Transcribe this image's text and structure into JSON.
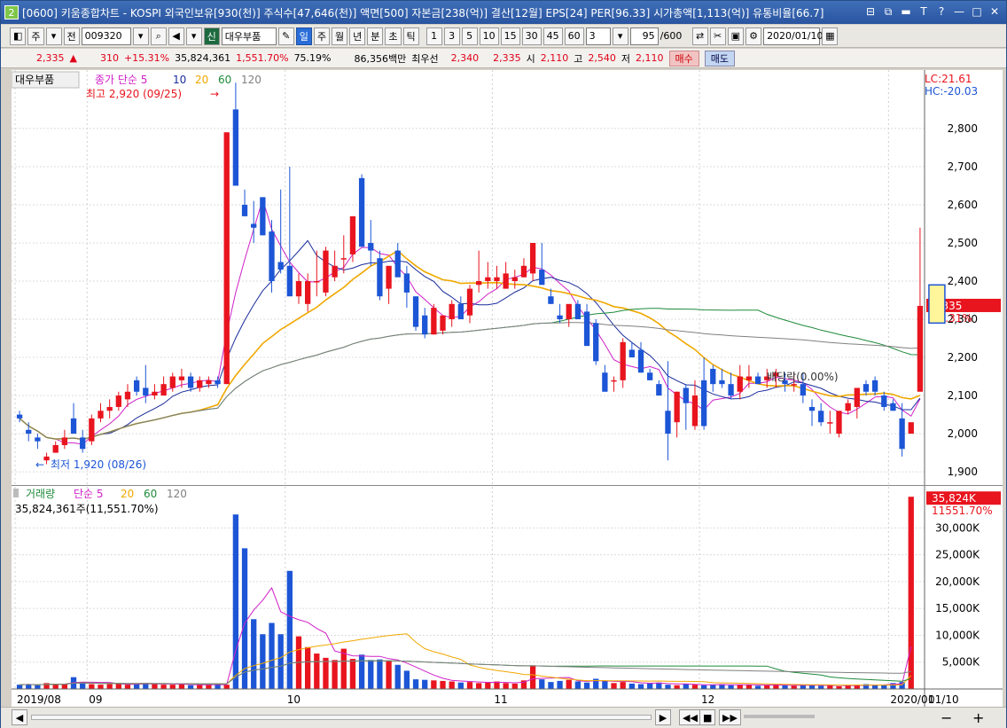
{
  "window": {
    "icon_label": "2",
    "title": "[0600] 키움종합차트 - KOSPI 외국인보유[930(천)] 주식수[47,646(천)] 액면[500] 자본금[238(억)] 결산[12월] EPS[24] PER[96.33] 시가총액[1,113(억)] 유통비율[66.7]",
    "controls": [
      "⊟",
      "⧉",
      "▬",
      "T",
      "?",
      "—",
      "□",
      "✕"
    ]
  },
  "toolbar": {
    "period_select": "주",
    "prev_label": "전",
    "code": "009320",
    "sin_label": "신",
    "stock_name": "대우부품",
    "period_tabs": [
      "일",
      "주",
      "월",
      "년",
      "분",
      "초",
      "틱"
    ],
    "active_period": "일",
    "intervals": [
      "1",
      "3",
      "5",
      "10",
      "15",
      "30",
      "45",
      "60"
    ],
    "custom_interval": "3",
    "count_value": "95",
    "count_total": "/600",
    "date": "2020/01/10"
  },
  "quote": {
    "price": "2,335",
    "change_arrow": "▲",
    "change": "310",
    "change_pct": "+15.31%",
    "volume": "35,824,361",
    "volume_ratio": "1,551.70%",
    "turnover": "75.19%",
    "amount": "86,356백만",
    "best_label": "최우선",
    "bid1": "2,340",
    "bid2": "2,335",
    "open_label": "시",
    "open": "2,110",
    "high_label": "고",
    "high": "2,540",
    "low_label": "저",
    "low": "2,110",
    "buy_label": "매수",
    "sell_label": "매도"
  },
  "colors": {
    "up": "#e8141e",
    "down": "#1c55d6",
    "ma5": "#d020c8",
    "ma10": "#1a2c9c",
    "ma20": "#f0a800",
    "ma60": "#1e8a3a",
    "ma120": "#808080"
  },
  "chart_data": {
    "type": "candlestick",
    "price_panel": {
      "legend_name": "대우부품",
      "legend_items": [
        "종가 단순 5",
        "10",
        "20",
        "60",
        "120"
      ],
      "max_annotation": "최고 2,920 (09/25)",
      "min_annotation": "최저 1,920 (08/26)",
      "dividend_annotation": "배당락(0.00%)",
      "lc_label": "LC:21.61",
      "hc_label": "HC:-20.03",
      "current_price_label": "2,335",
      "current_change_label": "15.31%",
      "y_ticks": [
        1900,
        2000,
        2100,
        2200,
        2300,
        2400,
        2500,
        2600,
        2700,
        2800
      ],
      "ylim": [
        1870,
        2930
      ],
      "ohlc": [
        [
          2050,
          2060,
          2030,
          2040
        ],
        [
          2010,
          2030,
          1980,
          2000
        ],
        [
          1990,
          2000,
          1960,
          1980
        ],
        [
          1930,
          1950,
          1920,
          1940
        ],
        [
          1950,
          1980,
          1950,
          1970
        ],
        [
          1970,
          2010,
          1960,
          1990
        ],
        [
          2040,
          2080,
          2000,
          2000
        ],
        [
          1990,
          2010,
          1950,
          1960
        ],
        [
          1980,
          2050,
          1970,
          2040
        ],
        [
          2040,
          2080,
          2030,
          2060
        ],
        [
          2060,
          2090,
          2040,
          2070
        ],
        [
          2070,
          2110,
          2060,
          2100
        ],
        [
          2090,
          2130,
          2070,
          2110
        ],
        [
          2140,
          2150,
          2100,
          2110
        ],
        [
          2120,
          2180,
          2080,
          2100
        ],
        [
          2100,
          2130,
          2090,
          2110
        ],
        [
          2100,
          2150,
          2100,
          2130
        ],
        [
          2120,
          2160,
          2110,
          2150
        ],
        [
          2140,
          2170,
          2120,
          2150
        ],
        [
          2150,
          2160,
          2110,
          2120
        ],
        [
          2120,
          2150,
          2110,
          2140
        ],
        [
          2130,
          2150,
          2120,
          2140
        ],
        [
          2140,
          2150,
          2120,
          2130
        ],
        [
          2130,
          2790,
          2130,
          2790
        ],
        [
          2850,
          2920,
          2700,
          2650
        ],
        [
          2600,
          2640,
          2570,
          2570
        ],
        [
          2550,
          2610,
          2500,
          2540
        ],
        [
          2620,
          2620,
          2520,
          2520
        ],
        [
          2530,
          2560,
          2370,
          2400
        ],
        [
          2450,
          2640,
          2420,
          2430
        ],
        [
          2440,
          2700,
          2400,
          2360
        ],
        [
          2360,
          2420,
          2340,
          2400
        ],
        [
          2340,
          2420,
          2320,
          2400
        ],
        [
          2400,
          2480,
          2360,
          2400
        ],
        [
          2370,
          2490,
          2360,
          2480
        ],
        [
          2410,
          2480,
          2400,
          2440
        ],
        [
          2460,
          2520,
          2420,
          2460
        ],
        [
          2470,
          2570,
          2450,
          2570
        ],
        [
          2670,
          2680,
          2490,
          2490
        ],
        [
          2500,
          2560,
          2440,
          2480
        ],
        [
          2460,
          2480,
          2350,
          2360
        ],
        [
          2380,
          2430,
          2340,
          2440
        ],
        [
          2480,
          2500,
          2440,
          2410
        ],
        [
          2420,
          2440,
          2330,
          2370
        ],
        [
          2360,
          2360,
          2270,
          2280
        ],
        [
          2310,
          2330,
          2250,
          2260
        ],
        [
          2260,
          2340,
          2260,
          2330
        ],
        [
          2270,
          2300,
          2260,
          2310
        ],
        [
          2300,
          2350,
          2280,
          2340
        ],
        [
          2340,
          2360,
          2300,
          2300
        ],
        [
          2310,
          2390,
          2290,
          2380
        ],
        [
          2390,
          2480,
          2370,
          2400
        ],
        [
          2400,
          2450,
          2380,
          2410
        ],
        [
          2400,
          2440,
          2380,
          2410
        ],
        [
          2380,
          2450,
          2380,
          2420
        ],
        [
          2400,
          2430,
          2380,
          2410
        ],
        [
          2410,
          2460,
          2410,
          2440
        ],
        [
          2420,
          2470,
          2400,
          2500
        ],
        [
          2430,
          2500,
          2420,
          2390
        ],
        [
          2360,
          2380,
          2340,
          2340
        ],
        [
          2310,
          2340,
          2290,
          2300
        ],
        [
          2300,
          2320,
          2280,
          2340
        ],
        [
          2340,
          2350,
          2300,
          2300
        ],
        [
          2320,
          2340,
          2230,
          2230
        ],
        [
          2290,
          2300,
          2180,
          2190
        ],
        [
          2160,
          2180,
          2110,
          2110
        ],
        [
          2140,
          2150,
          2110,
          2140
        ],
        [
          2140,
          2250,
          2120,
          2240
        ],
        [
          2220,
          2240,
          2200,
          2200
        ],
        [
          2220,
          2240,
          2160,
          2160
        ],
        [
          2160,
          2170,
          2140,
          2140
        ],
        [
          2130,
          2140,
          2100,
          2100
        ],
        [
          2060,
          2190,
          1930,
          2000
        ],
        [
          2030,
          2110,
          1990,
          2110
        ],
        [
          2120,
          2130,
          2010,
          2080
        ],
        [
          2020,
          2140,
          2010,
          2100
        ],
        [
          2140,
          2200,
          2010,
          2020
        ],
        [
          2170,
          2180,
          2110,
          2130
        ],
        [
          2140,
          2170,
          2120,
          2130
        ],
        [
          2130,
          2160,
          2090,
          2100
        ],
        [
          2110,
          2180,
          2090,
          2150
        ],
        [
          2140,
          2180,
          2120,
          2150
        ],
        [
          2150,
          2160,
          2130,
          2130
        ],
        [
          2140,
          2170,
          2120,
          2150
        ],
        [
          2150,
          2170,
          2120,
          2160
        ],
        [
          2140,
          2160,
          2110,
          2130
        ],
        [
          2130,
          2160,
          2110,
          2130
        ],
        [
          2130,
          2160,
          2080,
          2100
        ],
        [
          2070,
          2090,
          2020,
          2060
        ],
        [
          2060,
          2080,
          2020,
          2030
        ],
        [
          2030,
          2060,
          2000,
          2030
        ],
        [
          2000,
          2040,
          1990,
          2060
        ],
        [
          2060,
          2090,
          2050,
          2080
        ],
        [
          2070,
          2120,
          2040,
          2120
        ],
        [
          2130,
          2140,
          2100,
          2110
        ],
        [
          2140,
          2150,
          2100,
          2110
        ],
        [
          2100,
          2110,
          2060,
          2070
        ],
        [
          2080,
          2090,
          2060,
          2060
        ],
        [
          2040,
          2080,
          1940,
          1960
        ],
        [
          2000,
          2020,
          2000,
          2030
        ],
        [
          2110,
          2540,
          2110,
          2335
        ]
      ]
    },
    "volume_panel": {
      "legend_name": "거래량",
      "legend_items": [
        "단순 5",
        "20",
        "60",
        "120"
      ],
      "info": "35,824,361주(11,551.70%)",
      "current_label": "35,824K",
      "current_pct": "11551.70%",
      "y_ticks": [
        "5,000K",
        "10,000K",
        "15,000K",
        "20,000K",
        "25,000K",
        "30,000K"
      ],
      "ylim": [
        0,
        36000
      ],
      "values": [
        800,
        900,
        700,
        1100,
        900,
        950,
        2200,
        1300,
        900,
        800,
        900,
        950,
        800,
        1000,
        1100,
        900,
        800,
        800,
        900,
        700,
        800,
        800,
        900,
        800,
        32500,
        26200,
        13000,
        10200,
        12300,
        10200,
        22000,
        9800,
        7800,
        6600,
        5800,
        5400,
        7500,
        5600,
        6400,
        5400,
        5500,
        5300,
        4500,
        3400,
        1800,
        1700,
        1600,
        1500,
        1400,
        1200,
        1300,
        1100,
        1200,
        1400,
        1100,
        1000,
        1600,
        4400,
        1800,
        1300,
        1500,
        1700,
        1400,
        1200,
        1900,
        1500,
        1100,
        1300,
        1000,
        900,
        1100,
        1200,
        800,
        700,
        900,
        800,
        700,
        800,
        900,
        700,
        800,
        800,
        600,
        700,
        800,
        700,
        600,
        700,
        800,
        600,
        700,
        500,
        600,
        800,
        900,
        800,
        700,
        1100,
        1300,
        35800
      ]
    },
    "x_axis": {
      "labels": [
        "2019/08",
        "09",
        "10",
        "11",
        "12",
        "2020/01",
        "01/10"
      ],
      "label_bars": [
        0,
        8,
        30,
        53,
        76,
        97
      ]
    }
  },
  "bottom": {
    "nav_buttons": [
      "◀",
      "▶",
      "◀◀",
      "■",
      "▶▶"
    ]
  }
}
